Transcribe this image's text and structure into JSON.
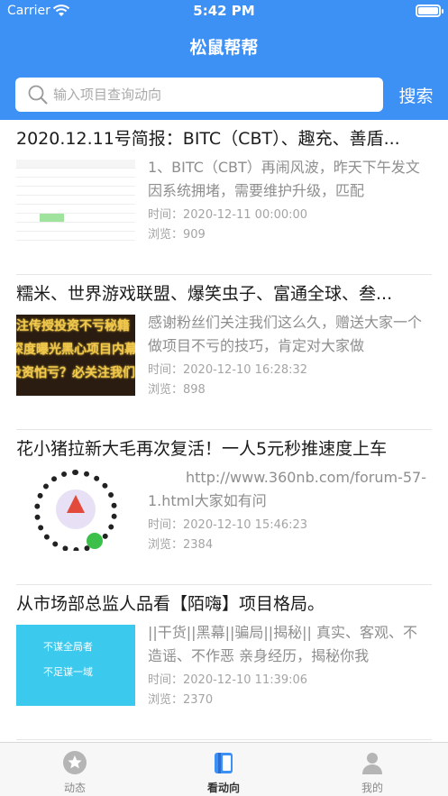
{
  "status_bar": {
    "carrier": "Carrier",
    "time": "5:42 PM"
  },
  "header": {
    "title": "松鼠帮帮"
  },
  "search": {
    "placeholder": "输入项目查询动向",
    "button_label": "搜索"
  },
  "articles": [
    {
      "title": "2020.12.11号简报：BITC（CBT）、趣充、善盾...",
      "summary": "1、BITC（CBT）再闹风波，昨天下午发文因系统拥堵，需要维护升级，匹配",
      "time": "时间：2020-12-11 00:00:00",
      "views": "浏览：909"
    },
    {
      "title": "糯米、世界游戏联盟、爆笑虫子、富通全球、叁...",
      "summary": "感谢粉丝们关注我们这么久，赠送大家一个做项目不亏的技巧，肯定对大家做",
      "time": "时间：2020-12-10 16:28:32",
      "views": "浏览：898",
      "thumb_text": [
        "专注传授投资不亏秘籍",
        "深度曝光黑心项目内幕",
        "投资怕亏？必关注我们"
      ]
    },
    {
      "title": "花小猪拉新大毛再次复活！一人5元秒推速度上车",
      "summary": "http://www.360nb.com/forum-57-1.html大家如有问",
      "time": "时间：2020-12-10 15:46:23",
      "views": "浏览：2384"
    },
    {
      "title": "从市场部总监人品看【陌嗨】项目格局。",
      "summary": "||干货||黑幕||骗局||揭秘|| 真实、客观、不造谣、不作恶 亲身经历，揭秘你我",
      "time": "时间：2020-12-10 11:39:06",
      "views": "浏览：2370",
      "thumb_text": [
        "不谋全局者",
        "不足谋一域"
      ]
    }
  ],
  "tabbar": {
    "tabs": [
      {
        "label": "动态",
        "icon": "star-icon",
        "active": false
      },
      {
        "label": "看动向",
        "icon": "book-icon",
        "active": true
      },
      {
        "label": "我的",
        "icon": "person-icon",
        "active": false
      }
    ]
  },
  "colors": {
    "brand": "#3d90f4",
    "text_muted": "#8e8e8e"
  }
}
